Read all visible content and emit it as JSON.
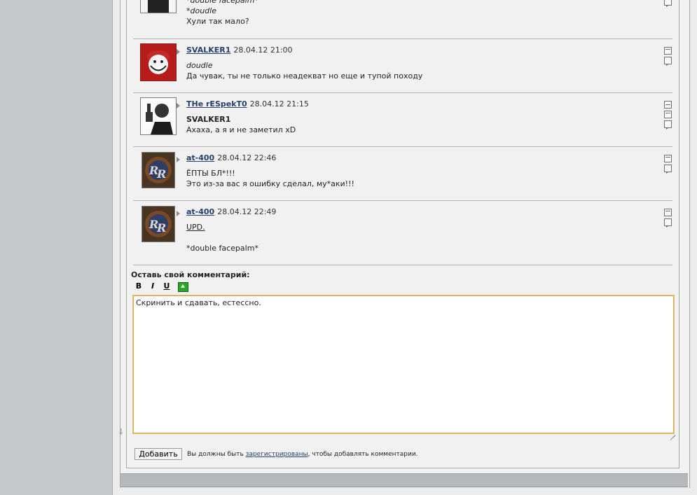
{
  "comments": [
    {
      "body": [
        "*double facepalm*",
        "*doudle",
        "Хули так мало?"
      ]
    },
    {
      "author": "SVALKER1",
      "date": "28.04.12 21:00",
      "quote": "doudle",
      "text": "Да чувак, ты не только неадекват но еще и тупой походу"
    },
    {
      "author": "THe rESpekT0",
      "date": "28.04.12 21:15",
      "quote": "SVALKER1",
      "text": "Ахаха, а я и не заметил xD"
    },
    {
      "author": "at-400",
      "date": "28.04.12 22:46",
      "line1": "ЁПТЫ БЛ*!!!",
      "line2": "Это из-за вас я ошибку сделал, му*аки!!!"
    },
    {
      "author": "at-400",
      "date": "28.04.12 22:49",
      "line1": "UPD.",
      "line2": "*double facepalm*"
    }
  ],
  "form": {
    "title": "Оставь свой комментарий:",
    "toolbar": {
      "bold": "B",
      "italic": "I",
      "underline": "U"
    },
    "textarea_value": "Скринить и сдавать, естессно.",
    "submit_label": "Добавить",
    "notice_prefix": "Вы должны быть ",
    "notice_link": "зарегистрированы",
    "notice_suffix": ", чтобы добавлять комментарии."
  },
  "colors": {
    "link": "#27406b",
    "textarea_border": "#d6a84a",
    "insert_image_icon": "#27a827"
  },
  "icons": [
    "reply-icon",
    "mail-icon",
    "quote-icon",
    "insert-image-icon"
  ]
}
